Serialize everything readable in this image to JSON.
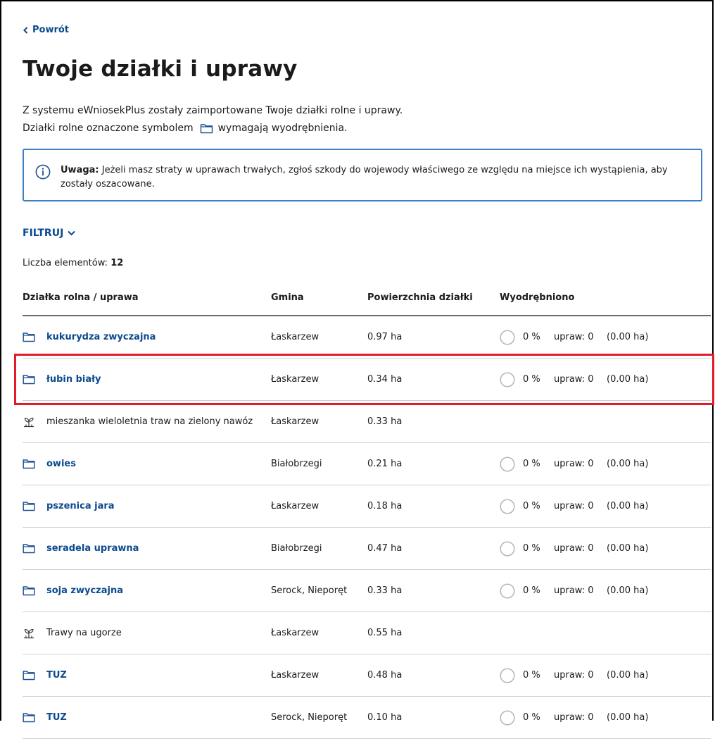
{
  "nav": {
    "back_label": "Powrót"
  },
  "page": {
    "title": "Twoje działki i uprawy",
    "intro_line1": "Z systemu eWniosekPlus zostały zaimportowane Twoje działki rolne i uprawy.",
    "intro_line2_before": "Działki rolne oznaczone symbolem",
    "intro_line2_after": "wymagają wyodrębnienia."
  },
  "alert": {
    "label": "Uwaga:",
    "text": " Jeżeli masz straty w uprawach trwałych, zgłoś szkody do wojewody właściwego ze względu na miejsce ich wystąpienia, aby zostały oszacowane.",
    "accent_color": "#3d7fc9"
  },
  "filter": {
    "label": "FILTRUJ"
  },
  "count": {
    "label": "Liczba elementów:",
    "value": "12"
  },
  "table": {
    "headers": {
      "name": "Działka rolna / uprawa",
      "gmina": "Gmina",
      "area": "Powierzchnia działki",
      "separated": "Wyodrębniono"
    },
    "rows": [
      {
        "icon": "folder-icon",
        "name": "kukurydza zwyczajna",
        "link": true,
        "gmina": "Łaskarzew",
        "area": "0.97 ha",
        "pct": "0 %",
        "crops": "upraw: 0",
        "crops_area": "(0.00 ha)"
      },
      {
        "icon": "folder-icon",
        "name": "łubin biały",
        "link": true,
        "gmina": "Łaskarzew",
        "area": "0.34 ha",
        "pct": "0 %",
        "crops": "upraw: 0",
        "crops_area": "(0.00 ha)"
      },
      {
        "icon": "sprout-icon",
        "name": "mieszanka wieloletnia traw na zielony nawóz",
        "link": false,
        "gmina": "Łaskarzew",
        "area": "0.33 ha",
        "pct": "",
        "crops": "",
        "crops_area": ""
      },
      {
        "icon": "folder-icon",
        "name": "owies",
        "link": true,
        "gmina": "Białobrzegi",
        "area": "0.21 ha",
        "pct": "0 %",
        "crops": "upraw: 0",
        "crops_area": "(0.00 ha)"
      },
      {
        "icon": "folder-icon",
        "name": "pszenica jara",
        "link": true,
        "gmina": "Łaskarzew",
        "area": "0.18 ha",
        "pct": "0 %",
        "crops": "upraw: 0",
        "crops_area": "(0.00 ha)"
      },
      {
        "icon": "folder-icon",
        "name": "seradela uprawna",
        "link": true,
        "gmina": "Białobrzegi",
        "area": "0.47 ha",
        "pct": "0 %",
        "crops": "upraw: 0",
        "crops_area": "(0.00 ha)"
      },
      {
        "icon": "folder-icon",
        "name": "soja zwyczajna",
        "link": true,
        "gmina": "Serock, Nieporęt",
        "area": "0.33 ha",
        "pct": "0 %",
        "crops": "upraw: 0",
        "crops_area": "(0.00 ha)"
      },
      {
        "icon": "sprout-icon",
        "name": "Trawy na ugorze",
        "link": false,
        "gmina": "Łaskarzew",
        "area": "0.55 ha",
        "pct": "",
        "crops": "",
        "crops_area": ""
      },
      {
        "icon": "folder-icon",
        "name": "TUZ",
        "link": true,
        "gmina": "Łaskarzew",
        "area": "0.48 ha",
        "pct": "0 %",
        "crops": "upraw: 0",
        "crops_area": "(0.00 ha)"
      },
      {
        "icon": "folder-icon",
        "name": "TUZ",
        "link": true,
        "gmina": "Serock, Nieporęt",
        "area": "0.10 ha",
        "pct": "0 %",
        "crops": "upraw: 0",
        "crops_area": "(0.00 ha)"
      }
    ]
  },
  "colors": {
    "link": "#0b4a8f",
    "highlight": "#e21b2a",
    "ring": "#b5b5b5"
  }
}
